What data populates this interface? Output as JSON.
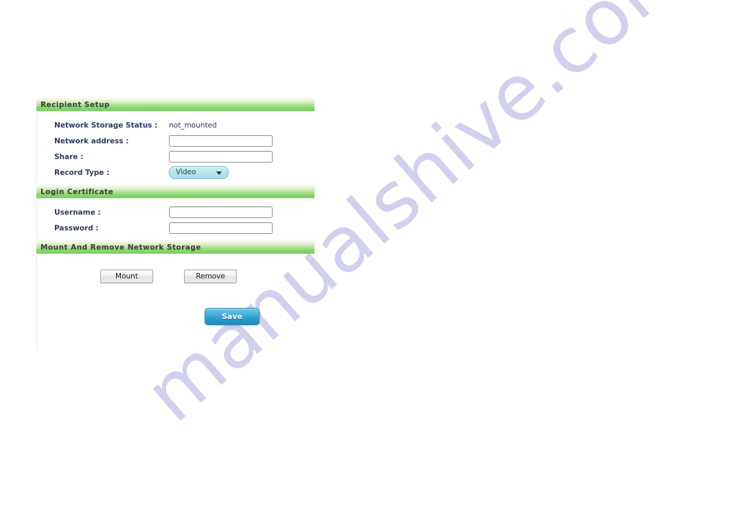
{
  "watermark": {
    "text": "manualshive.com",
    "color": "#c9caec"
  },
  "sections": [
    {
      "id": "recipient-setup",
      "title": "Recipient Setup",
      "rows": [
        {
          "type": "static",
          "label": "Network Storage Status :",
          "value": "not_mounted"
        },
        {
          "type": "text",
          "label": "Network address :",
          "value": "",
          "placeholder": ""
        },
        {
          "type": "text",
          "label": "Share :",
          "value": "",
          "placeholder": ""
        },
        {
          "type": "select",
          "label": "Record Type :",
          "value": "Video",
          "options": [
            "Video"
          ],
          "arrow_icon": "chevron-down-icon"
        }
      ]
    },
    {
      "id": "login-certificate",
      "title": "Login Certificate",
      "rows": [
        {
          "type": "text",
          "label": "Username :",
          "value": "",
          "placeholder": ""
        },
        {
          "type": "password",
          "label": "Password :",
          "value": "",
          "placeholder": ""
        }
      ]
    },
    {
      "id": "mount-and-remove",
      "title": "Mount And Remove Network Storage",
      "buttons": [
        {
          "label": "Mount"
        },
        {
          "label": "Remove"
        }
      ]
    }
  ],
  "save": {
    "label": "Save"
  },
  "colors": {
    "header_green": "#79cf63",
    "label_navy": "#2e3a60",
    "save_blue": "#2b9ccb",
    "pill_cyan": "#b4e4ee"
  }
}
